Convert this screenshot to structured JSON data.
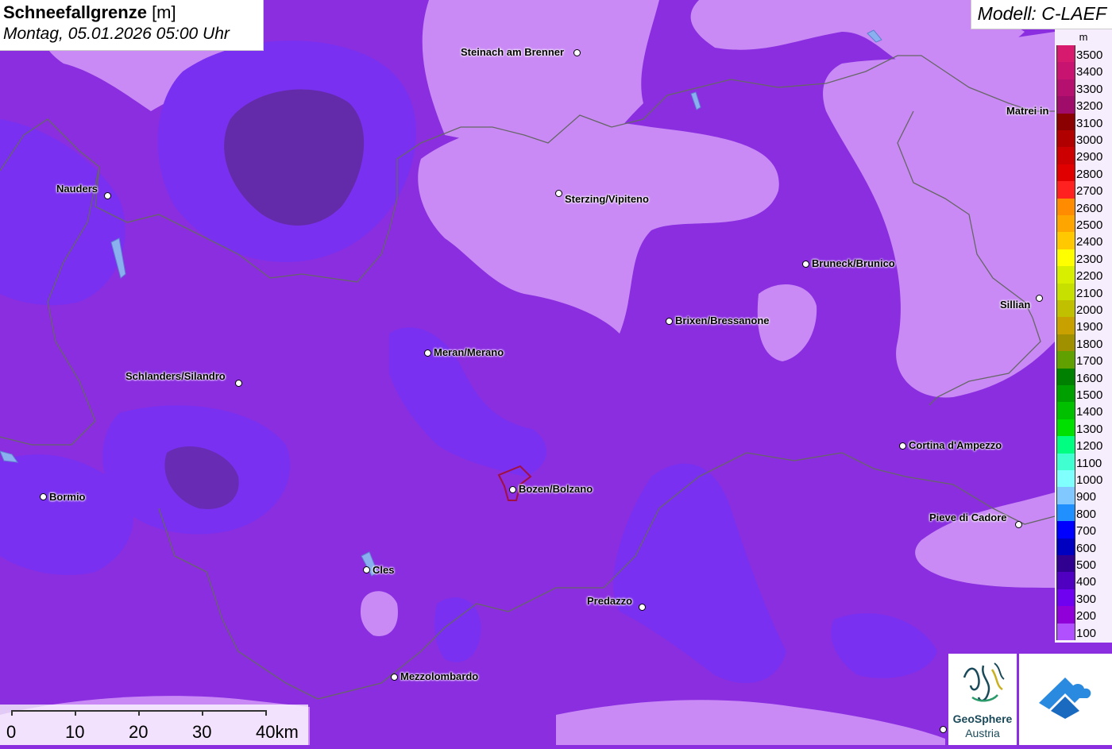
{
  "title": {
    "main_bold": "Schneefallgrenze",
    "main_unit": " [m]",
    "datetime": "Montag, 05.01.2026 05:00 Uhr"
  },
  "model": "Modell: C-LAEF",
  "legend": {
    "unit": "m",
    "entries": [
      {
        "label": "3500",
        "color": "#d81a6e"
      },
      {
        "label": "3400",
        "color": "#c81470"
      },
      {
        "label": "3300",
        "color": "#b51070"
      },
      {
        "label": "3200",
        "color": "#a00c6a"
      },
      {
        "label": "3100",
        "color": "#8b0000"
      },
      {
        "label": "3000",
        "color": "#b00000"
      },
      {
        "label": "2900",
        "color": "#cc0000"
      },
      {
        "label": "2800",
        "color": "#e00000"
      },
      {
        "label": "2700",
        "color": "#ff2020"
      },
      {
        "label": "2600",
        "color": "#ff8c00"
      },
      {
        "label": "2500",
        "color": "#ffa500"
      },
      {
        "label": "2400",
        "color": "#ffc800"
      },
      {
        "label": "2300",
        "color": "#ffff00"
      },
      {
        "label": "2200",
        "color": "#d8f000"
      },
      {
        "label": "2100",
        "color": "#c8e000"
      },
      {
        "label": "2000",
        "color": "#c0c000"
      },
      {
        "label": "1900",
        "color": "#c8a000"
      },
      {
        "label": "1800",
        "color": "#a09000"
      },
      {
        "label": "1700",
        "color": "#60a000"
      },
      {
        "label": "1600",
        "color": "#008000"
      },
      {
        "label": "1500",
        "color": "#00a000"
      },
      {
        "label": "1400",
        "color": "#00c000"
      },
      {
        "label": "1300",
        "color": "#00e000"
      },
      {
        "label": "1200",
        "color": "#00ff80"
      },
      {
        "label": "1100",
        "color": "#40ffd0"
      },
      {
        "label": "1000",
        "color": "#80ffff"
      },
      {
        "label": "900",
        "color": "#80c8ff"
      },
      {
        "label": "800",
        "color": "#2090ff"
      },
      {
        "label": "700",
        "color": "#0000ff"
      },
      {
        "label": "600",
        "color": "#0000c0"
      },
      {
        "label": "500",
        "color": "#300090"
      },
      {
        "label": "400",
        "color": "#5000c0"
      },
      {
        "label": "300",
        "color": "#7000f0"
      },
      {
        "label": "200",
        "color": "#9000d8"
      },
      {
        "label": "100",
        "color": "#b050ff"
      }
    ]
  },
  "cities": [
    {
      "name": "Steinach am Brenner"
    },
    {
      "name": "Matrei in"
    },
    {
      "name": "Nauders"
    },
    {
      "name": "Sterzing/Vipiteno"
    },
    {
      "name": "Bruneck/Brunico"
    },
    {
      "name": "Sillian"
    },
    {
      "name": "Brixen/Bressanone"
    },
    {
      "name": "Meran/Merano"
    },
    {
      "name": "Schlanders/Silandro"
    },
    {
      "name": "Cortina d'Ampezzo"
    },
    {
      "name": "Bozen/Bolzano"
    },
    {
      "name": "Bormio"
    },
    {
      "name": "Pieve di Cadore"
    },
    {
      "name": "Cles"
    },
    {
      "name": "Predazzo"
    },
    {
      "name": "Mezzolombardo"
    }
  ],
  "scale": {
    "labels": [
      "0",
      "10",
      "20",
      "30",
      "40km"
    ]
  },
  "logos": {
    "geosphere_line1": "GeoSphere",
    "geosphere_line2": "Austria"
  },
  "colors": {
    "base": "#8a2ee0",
    "light": "#c98af5",
    "blue": "#7a30f0",
    "dark": "#5a2a8a"
  }
}
